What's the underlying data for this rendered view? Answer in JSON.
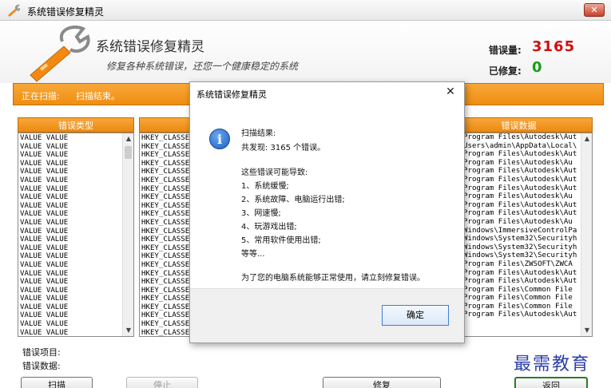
{
  "window": {
    "title": "系统错误修复精灵",
    "close_label": "✕"
  },
  "header": {
    "app_title": "系统错误修复精灵",
    "subtitle": "修复各种系统错误，还您一个健康稳定的系统",
    "error_count_label": "错误量:",
    "error_count": "3165",
    "fixed_count_label": "已修复:",
    "fixed_count": "0"
  },
  "scan": {
    "label": "正在扫描:",
    "status": "扫描结束。"
  },
  "columns": {
    "error_type": "错误类型",
    "error_data": "错误数据"
  },
  "list_type_rows": [
    "VALUE VALUE",
    "VALUE VALUE",
    "VALUE VALUE",
    "VALUE VALUE",
    "VALUE VALUE",
    "VALUE VALUE",
    "VALUE VALUE",
    "VALUE VALUE",
    "VALUE VALUE",
    "VALUE VALUE",
    "VALUE VALUE",
    "VALUE VALUE",
    "VALUE VALUE",
    "VALUE VALUE",
    "VALUE VALUE",
    "VALUE VALUE",
    "VALUE VALUE",
    "VALUE VALUE",
    "VALUE VALUE",
    "VALUE VALUE",
    "VALUE VALUE",
    "VALUE VALUE",
    "VALUE VALUE",
    "VALUE VALUE"
  ],
  "list_key_rows": [
    "HKEY_CLASSE",
    "HKEY_CLASSE",
    "HKEY_CLASSE",
    "HKEY_CLASSE",
    "HKEY_CLASSE",
    "HKEY_CLASSE",
    "HKEY_CLASSE",
    "HKEY_CLASSE",
    "HKEY_CLASSE",
    "HKEY_CLASSE",
    "HKEY_CLASSE",
    "HKEY_CLASSE",
    "HKEY_CLASSE",
    "HKEY_CLASSE",
    "HKEY_CLASSE",
    "HKEY_CLASSE",
    "HKEY_CLASSE",
    "HKEY_CLASSE",
    "HKEY_CLASSE",
    "HKEY_CLASSE",
    "HKEY_CLASSE",
    "HKEY_CLASSE",
    "HKEY_CLASSE",
    "HKEY_CLASSE"
  ],
  "list_data_rows": [
    "Program Files\\Autodesk\\Aut",
    "Users\\admin\\AppData\\Local\\",
    "Program Files\\Autodesk\\Aut",
    "Program Files\\Autodesk\\Au",
    "Program Files\\Autodesk\\Aut",
    "Program Files\\Autodesk\\Aut",
    "Program Files\\Autodesk\\Aut",
    "Program Files\\Autodesk\\Au",
    "Program Files\\Autodesk\\Aut",
    "Program Files\\Autodesk\\Aut",
    "Program Files\\Autodesk\\Au",
    "Windows\\ImmersiveControlPa",
    "Windows\\System32\\Securityh",
    "Windows\\System32\\Securityh",
    "Windows\\System32\\Securityh",
    "Program Files\\ZWSOFT\\ZWCA",
    "Program Files\\Autodesk\\Aut",
    "Program Files\\Autodesk\\Aut",
    "Program Files\\Common File",
    "Program Files\\Common File",
    "Program Files\\Common File",
    "Program Files\\Autodesk\\Aut"
  ],
  "footer": {
    "error_item_label": "错误项目:",
    "error_data_label": "错误数据:"
  },
  "buttons": {
    "scan": "扫描",
    "stop": "停止",
    "repair": "修复",
    "back": "返回"
  },
  "watermark": "最需教育",
  "dialog": {
    "title": "系统错误修复精灵",
    "close_label": "✕",
    "lines": [
      "扫描结果:",
      "共发现:  3165 个错误。",
      "这些错误可能导致:",
      "1、系统缓慢;",
      "2、系统故障、电脑运行出错;",
      "3、网速慢;",
      "4、玩游戏出错;",
      "5、常用软件使用出错;",
      "等等...",
      "为了您的电脑系统能够正常使用，请立刻修复错误。"
    ],
    "ok_label": "确定"
  },
  "colors": {
    "accent_orange": "#ef8e10",
    "error_red": "#d01010",
    "fixed_green": "#12a012",
    "watermark_blue": "#2d3fa8"
  }
}
